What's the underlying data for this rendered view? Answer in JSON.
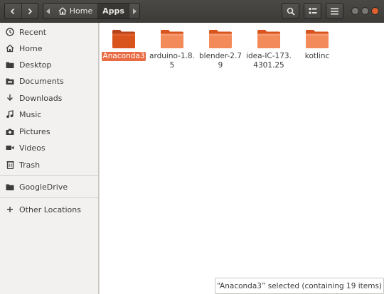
{
  "toolbar": {
    "back_icon": "chevron-left-icon",
    "forward_icon": "chevron-right-icon",
    "path_prev_icon": "triangle-left-icon",
    "path_next_icon": "triangle-right-icon",
    "breadcrumb": [
      {
        "label": "Home",
        "icon": "home-icon"
      },
      {
        "label": "Apps"
      }
    ],
    "search_icon": "search-icon",
    "view_icon": "grid-view-icon",
    "menu_icon": "hamburger-menu-icon"
  },
  "colors": {
    "accent": "#e96b43",
    "folder_light": "#f28a5a",
    "folder_dark": "#d9541c",
    "header": "#3d3c38"
  },
  "sidebar": {
    "items": [
      {
        "label": "Recent",
        "icon": "clock-icon"
      },
      {
        "label": "Home",
        "icon": "home-icon"
      },
      {
        "label": "Desktop",
        "icon": "folder-icon"
      },
      {
        "label": "Documents",
        "icon": "document-icon"
      },
      {
        "label": "Downloads",
        "icon": "download-arrow-icon"
      },
      {
        "label": "Music",
        "icon": "music-note-icon"
      },
      {
        "label": "Pictures",
        "icon": "camera-icon"
      },
      {
        "label": "Videos",
        "icon": "video-camera-icon"
      },
      {
        "label": "Trash",
        "icon": "trash-icon"
      },
      {
        "label": "GoogleDrive",
        "icon": "folder-icon"
      },
      {
        "label": "Other Locations",
        "icon": "plus-icon"
      }
    ]
  },
  "files": [
    {
      "name": "Anaconda3",
      "selected": true
    },
    {
      "name": "arduino-1.8.5",
      "selected": false
    },
    {
      "name": "blender-2.79",
      "selected": false
    },
    {
      "name": "idea-IC-173.4301.25",
      "selected": false
    },
    {
      "name": "kotlinc",
      "selected": false
    }
  ],
  "status": {
    "text": "“Anaconda3” selected  (containing 19 items)"
  }
}
